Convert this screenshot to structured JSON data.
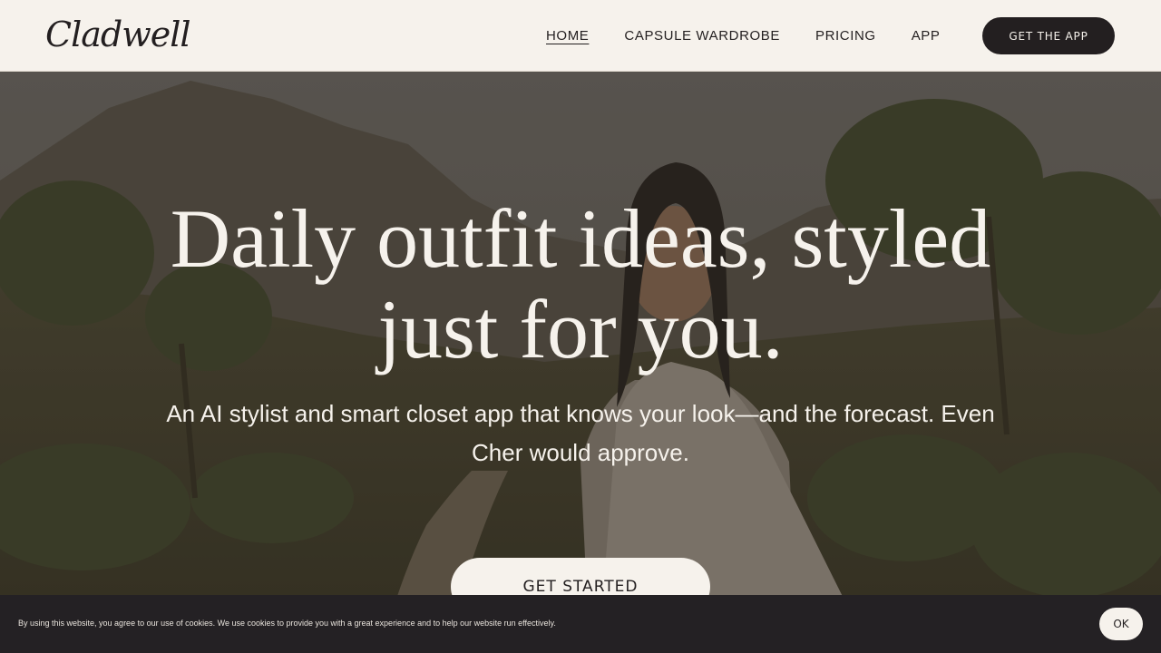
{
  "brand": {
    "logo_text": "Cladwell"
  },
  "nav": {
    "items": [
      {
        "label": "HOME",
        "active": true
      },
      {
        "label": "CAPSULE WARDROBE",
        "active": false
      },
      {
        "label": "PRICING",
        "active": false
      },
      {
        "label": "APP",
        "active": false
      }
    ],
    "cta_label": "GET THE APP"
  },
  "hero": {
    "title_line1": "Daily outfit ideas, styled",
    "title_line2": "just for you.",
    "subtitle": "An AI stylist and smart closet app that knows your look—and the forecast. Even Cher would approve.",
    "cta_label": "GET STARTED"
  },
  "cookie_banner": {
    "text": "By using this website, you agree to our use of cookies. We use cookies to provide you with a great experience and to help our website run effectively.",
    "ok_label": "OK"
  },
  "colors": {
    "cream": "#f6f2ec",
    "charcoal": "#231f20",
    "banner": "#242124"
  }
}
